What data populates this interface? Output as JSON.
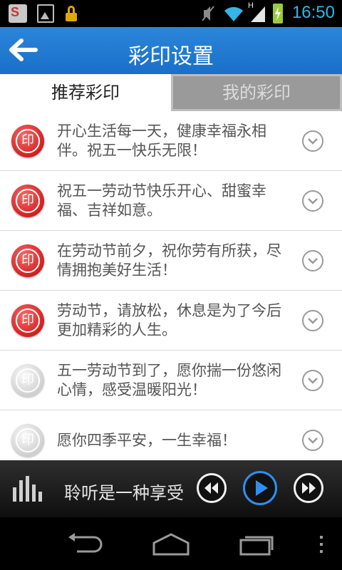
{
  "status_bar": {
    "time": "16:50",
    "network_label": "H",
    "icons": [
      "app-notification-icon",
      "gallery-icon",
      "lock-icon",
      "mute-icon",
      "wifi-icon",
      "signal-icon",
      "battery-charging-icon"
    ]
  },
  "header": {
    "title": "彩印设置",
    "back_icon": "back-arrow-icon",
    "color": "#1f78d1"
  },
  "tabs": [
    {
      "label": "推荐彩印",
      "selected": true
    },
    {
      "label": "我的彩印",
      "selected": false
    }
  ],
  "stamp_glyph": "印",
  "list": [
    {
      "text": "开心生活每一天，健康幸福永相伴。祝五一快乐无限！",
      "stamp": "red"
    },
    {
      "text": "祝五一劳动节快乐开心、甜蜜幸福、吉祥如意。",
      "stamp": "red"
    },
    {
      "text": "在劳动节前夕，祝你劳有所获，尽情拥抱美好生活！",
      "stamp": "red"
    },
    {
      "text": "劳动节，请放松，休息是为了今后更加精彩的人生。",
      "stamp": "red"
    },
    {
      "text": "五一劳动节到了，愿你揣一份悠闲心情，感受温暖阳光！",
      "stamp": "gray"
    },
    {
      "text": "愿你四季平安，一生幸福！",
      "stamp": "gray"
    }
  ],
  "player": {
    "text": "聆听是一种享受",
    "icons": [
      "equalizer-icon",
      "rewind-icon",
      "play-icon",
      "fast-forward-icon"
    ],
    "accent": "#2f8ff0"
  },
  "navbar": {
    "icons": [
      "back-icon",
      "home-icon",
      "recent-apps-icon",
      "menu-icon"
    ]
  }
}
